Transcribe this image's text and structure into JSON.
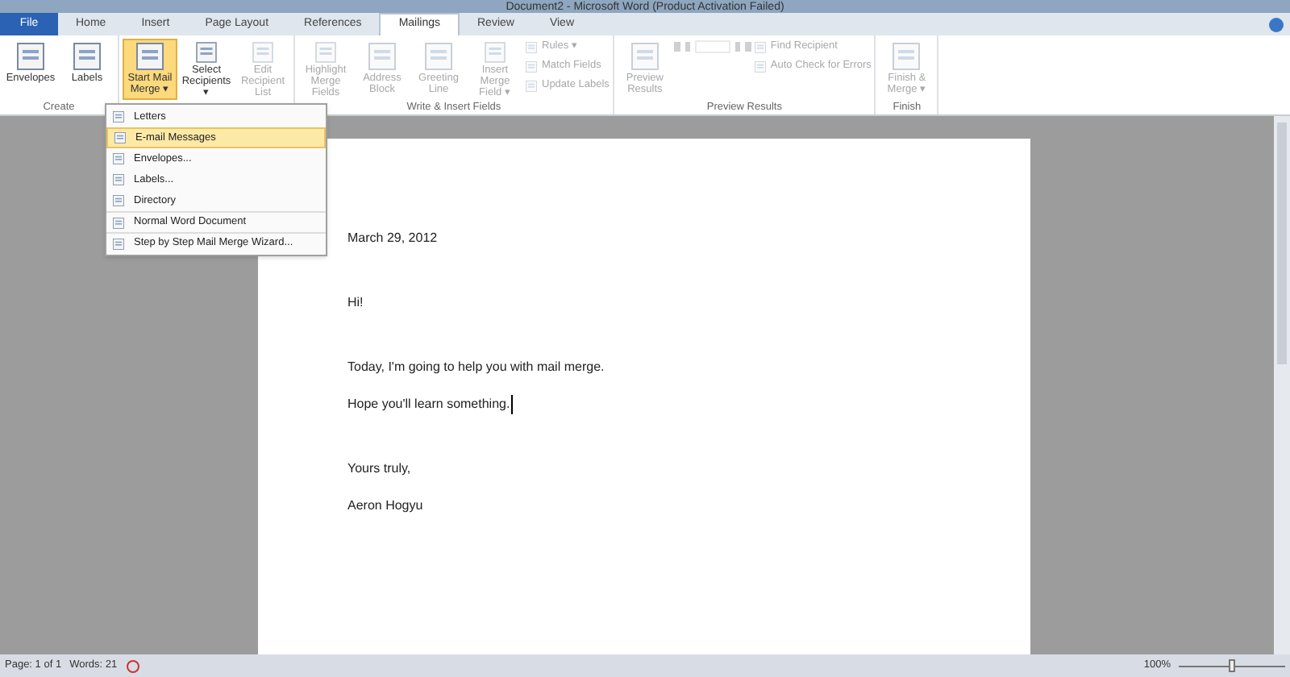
{
  "window": {
    "title": "Document2 - Microsoft Word (Product Activation Failed)"
  },
  "tabs": [
    {
      "label": "File",
      "kind": "file",
      "selected": false
    },
    {
      "label": "Home",
      "kind": "tab",
      "selected": false
    },
    {
      "label": "Insert",
      "kind": "tab",
      "selected": false
    },
    {
      "label": "Page Layout",
      "kind": "tab",
      "selected": false
    },
    {
      "label": "References",
      "kind": "tab",
      "selected": false
    },
    {
      "label": "Mailings",
      "kind": "tab",
      "selected": true
    },
    {
      "label": "Review",
      "kind": "tab",
      "selected": false
    },
    {
      "label": "View",
      "kind": "tab",
      "selected": false
    }
  ],
  "ribbon": {
    "groups": [
      {
        "label": "Create",
        "buttons": [
          {
            "kind": "large",
            "label": "Envelopes",
            "disabled": false,
            "selected": false
          },
          {
            "kind": "large",
            "label": "Labels",
            "disabled": false,
            "selected": false
          }
        ]
      },
      {
        "buttons": [
          {
            "kind": "large",
            "label": "Start Mail Merge ▾",
            "disabled": false,
            "selected": true
          },
          {
            "kind": "large",
            "label": "Select Recipients ▾",
            "disabled": false,
            "selected": false
          },
          {
            "kind": "large",
            "label": "Edit Recipient List",
            "disabled": true,
            "selected": false
          }
        ]
      },
      {
        "label": "Write & Insert Fields",
        "buttons": [
          {
            "kind": "large",
            "label": "Highlight Merge Fields",
            "disabled": true,
            "selected": false
          },
          {
            "kind": "large",
            "label": "Address Block",
            "disabled": true,
            "selected": false
          },
          {
            "kind": "large",
            "label": "Greeting Line",
            "disabled": true,
            "selected": false
          },
          {
            "kind": "large",
            "label": "Insert Merge Field ▾",
            "disabled": true,
            "selected": false
          },
          {
            "kind": "small",
            "label": "Rules ▾",
            "disabled": true
          },
          {
            "kind": "small",
            "label": "Match Fields",
            "disabled": true
          },
          {
            "kind": "small",
            "label": "Update Labels",
            "disabled": true
          }
        ]
      },
      {
        "label": "Preview Results",
        "buttons": [
          {
            "kind": "large",
            "label": "Preview Results",
            "disabled": true,
            "selected": false
          },
          {
            "kind": "nav",
            "disabled": true
          },
          {
            "kind": "small",
            "label": "Find Recipient",
            "disabled": true
          },
          {
            "kind": "small",
            "label": "Auto Check for Errors",
            "disabled": true
          }
        ]
      },
      {
        "label": "Finish",
        "buttons": [
          {
            "kind": "large",
            "label": "Finish & Merge ▾",
            "disabled": true,
            "selected": false
          }
        ]
      }
    ]
  },
  "menu": [
    {
      "label": "Letters",
      "selected": false
    },
    {
      "label": "E-mail Messages",
      "selected": true
    },
    {
      "label": "Envelopes...",
      "selected": false
    },
    {
      "label": "Labels...",
      "selected": false
    },
    {
      "label": "Directory",
      "selected": false
    },
    {
      "label": "Normal Word Document",
      "selected": false
    },
    {
      "label": "Step by Step Mail Merge Wizard...",
      "selected": false
    }
  ],
  "document": {
    "blocks": [
      [
        {
          "text": "March 29, 2012",
          "cursor": false
        }
      ],
      [
        {
          "text": "Hi!",
          "cursor": false
        }
      ],
      [
        {
          "text": "Today, I'm going to help you with mail merge.",
          "cursor": false
        },
        {
          "text": "Hope you'll learn something.",
          "cursor": true
        }
      ],
      [
        {
          "text": "Yours truly,",
          "cursor": false
        },
        {
          "text": "Aeron Hogyu",
          "cursor": false
        }
      ]
    ]
  },
  "status_bar": {
    "page": "Page: 1 of 1",
    "words": "Words: 21",
    "zoom": "100%",
    "zoom_slider": {
      "level": 0.5
    }
  }
}
